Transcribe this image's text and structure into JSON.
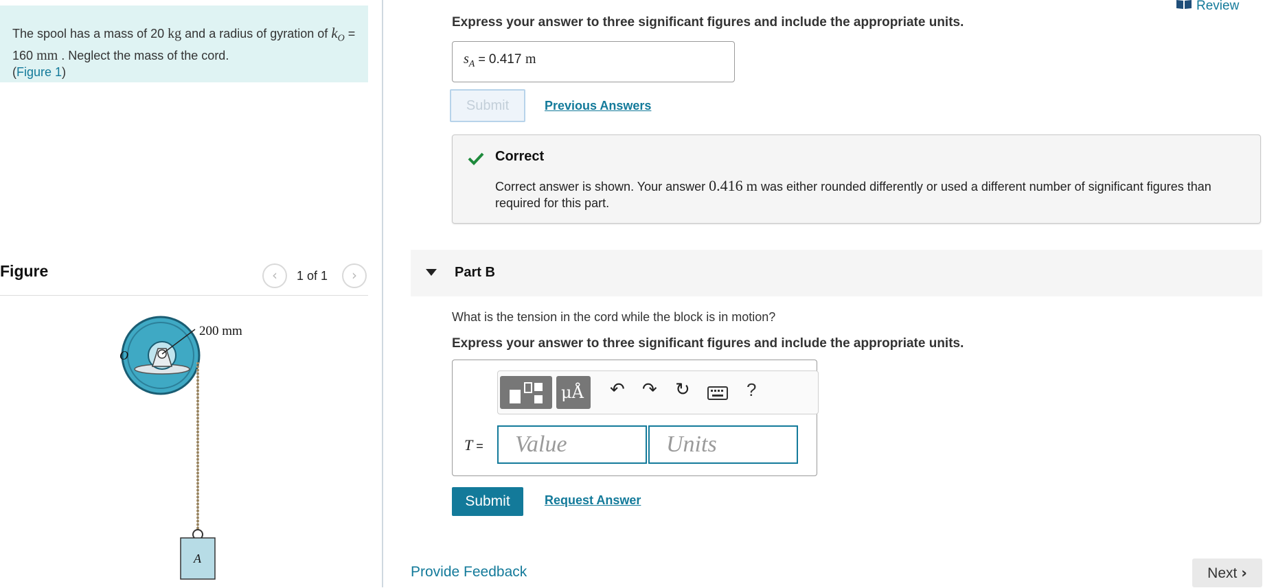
{
  "review": {
    "label": "Review"
  },
  "problem": {
    "text_1": "The spool has a mass of 20",
    "mass_unit": "kg",
    "text_2": "and a radius of gyration of",
    "k_symbol": "k",
    "k_sub": "O",
    "text_3": "= 160",
    "k_unit": "mm",
    "text_4": ". Neglect the mass of the cord.",
    "figure_link": "Figure 1"
  },
  "figure": {
    "heading": "Figure",
    "count": "1 of 1",
    "prev_icon": "chevron-left-icon",
    "next_icon": "chevron-right-icon",
    "radius_label": "200 mm",
    "center_label": "O",
    "block_label": "A"
  },
  "part_a": {
    "instruction": "Express your answer to three significant figures and include the appropriate units.",
    "answer_var": "s",
    "answer_sub": "A",
    "answer_eq": " = ",
    "answer_value": "0.417",
    "answer_unit": "m",
    "submit_label": "Submit",
    "previous_answers": "Previous Answers",
    "feedback": {
      "title": "Correct",
      "text_1": "Correct answer is shown. Your answer",
      "your_value": "0.416",
      "your_unit": "m",
      "text_2": "was either rounded differently or used a different number of significant figures than required for this part.",
      "icon": "checkmark-icon",
      "color": "#1e8a3c"
    }
  },
  "part_b": {
    "title": "Part B",
    "question": "What is the tension in the cord while the block is in motion?",
    "instruction": "Express your answer to three significant figures and include the appropriate units.",
    "toolbar": {
      "templates_icon": "templates-icon",
      "units_label": "μÅ",
      "undo_icon": "undo-icon",
      "redo_icon": "redo-icon",
      "reset_icon": "reset-icon",
      "keyboard_icon": "keyboard-icon",
      "help_label": "?"
    },
    "var_label": "T",
    "eq": " =",
    "value_placeholder": "Value",
    "units_placeholder": "Units",
    "submit_label": "Submit",
    "request_answer": "Request Answer"
  },
  "footer": {
    "provide_feedback": "Provide Feedback",
    "next_label": "Next"
  },
  "colors": {
    "accent": "#137a9a",
    "teal_panel": "#dff3f3",
    "spool": "#3fa9c4"
  }
}
